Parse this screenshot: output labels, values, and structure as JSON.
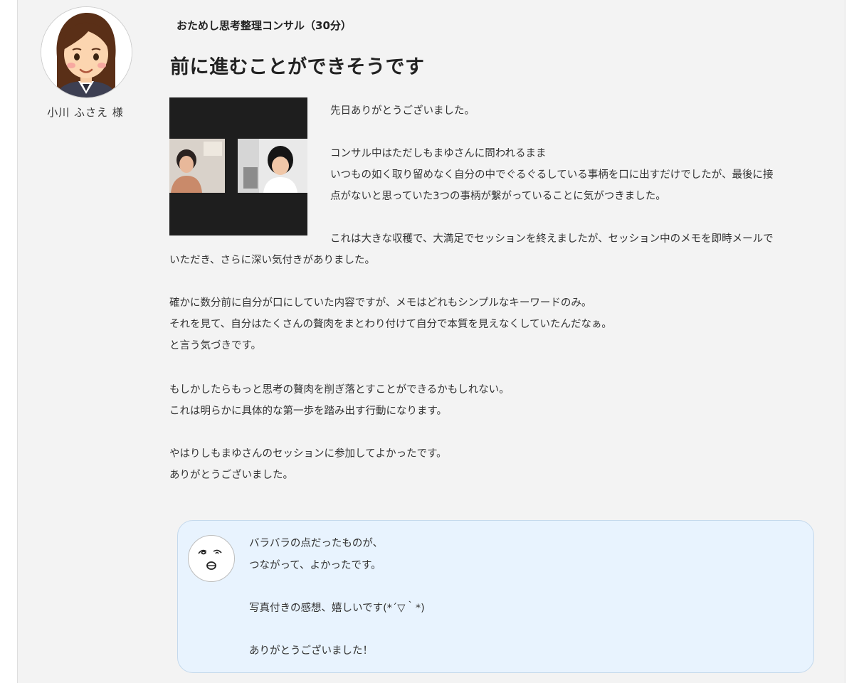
{
  "testimonial": {
    "service": "おためし思考整理コンサル（30分）",
    "title": "前に進むことができそうです",
    "author": "小川 ふさえ 様",
    "paragraphs": [
      "先日ありがとうございました。",
      "コンサル中はただしもまゆさんに問われるまま",
      "いつもの如く取り留めなく自分の中でぐるぐるしている事柄を口に出すだけでしたが、最後に接",
      "点がないと思っていた3つの事柄が繋がっていることに気がつきました。",
      "これは大きな収穫で、大満足でセッションを終えましたが、セッション中のメモを即時メールで",
      "いただき、さらに深い気付きがありました。",
      "確かに数分前に自分が口にしていた内容ですが、メモはどれもシンプルなキーワードのみ。",
      "それを見て、自分はたくさんの贅肉をまとわり付けて自分で本質を見えなくしていたんだなぁ。",
      "と言う気づきです。",
      "もしかしたらもっと思考の贅肉を削ぎ落とすことができるかもしれない。",
      "これは明らかに具体的な第一歩を踏み出す行動になります。",
      "やはりしもまゆさんのセッションに参加してよかったです。",
      "ありがとうございました。"
    ]
  },
  "reply": {
    "lines": [
      "バラバラの点だったものが、",
      "つながって、よかったです。",
      "写真付きの感想、嬉しいです(*´▽｀*)",
      "ありがとうございました！"
    ]
  },
  "colors": {
    "card_bg": "#f3f3f3",
    "reply_bg": "#e8f3fe",
    "reply_border": "#c5d9ec",
    "text": "#333333"
  }
}
